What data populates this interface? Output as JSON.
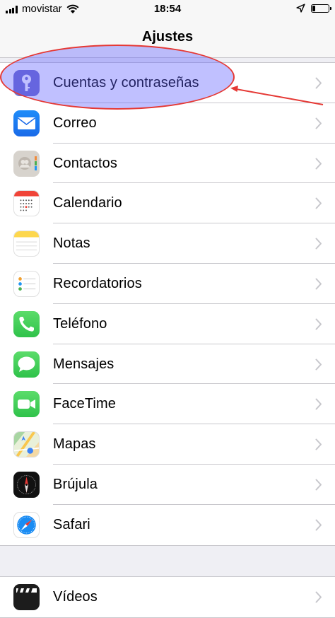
{
  "status_bar": {
    "carrier": "movistar",
    "time": "18:54",
    "battery_level_percent": 20
  },
  "nav": {
    "title": "Ajustes"
  },
  "settings": {
    "items": [
      {
        "label": "Cuentas y contraseñas",
        "icon": "key-icon"
      },
      {
        "label": "Correo",
        "icon": "mail-icon"
      },
      {
        "label": "Contactos",
        "icon": "contacts-icon"
      },
      {
        "label": "Calendario",
        "icon": "calendar-icon"
      },
      {
        "label": "Notas",
        "icon": "notes-icon"
      },
      {
        "label": "Recordatorios",
        "icon": "reminders-icon"
      },
      {
        "label": "Teléfono",
        "icon": "phone-icon"
      },
      {
        "label": "Mensajes",
        "icon": "messages-icon"
      },
      {
        "label": "FaceTime",
        "icon": "facetime-icon"
      },
      {
        "label": "Mapas",
        "icon": "maps-icon"
      },
      {
        "label": "Brújula",
        "icon": "compass-icon"
      },
      {
        "label": "Safari",
        "icon": "safari-icon"
      }
    ]
  },
  "media": {
    "items": [
      {
        "label": "Vídeos",
        "icon": "videos-icon"
      }
    ]
  },
  "colors": {
    "annotation_red": "#e53935",
    "highlight_fill": "#5a5aff",
    "separator": "#c8c7cc",
    "background": "#efeff4"
  }
}
